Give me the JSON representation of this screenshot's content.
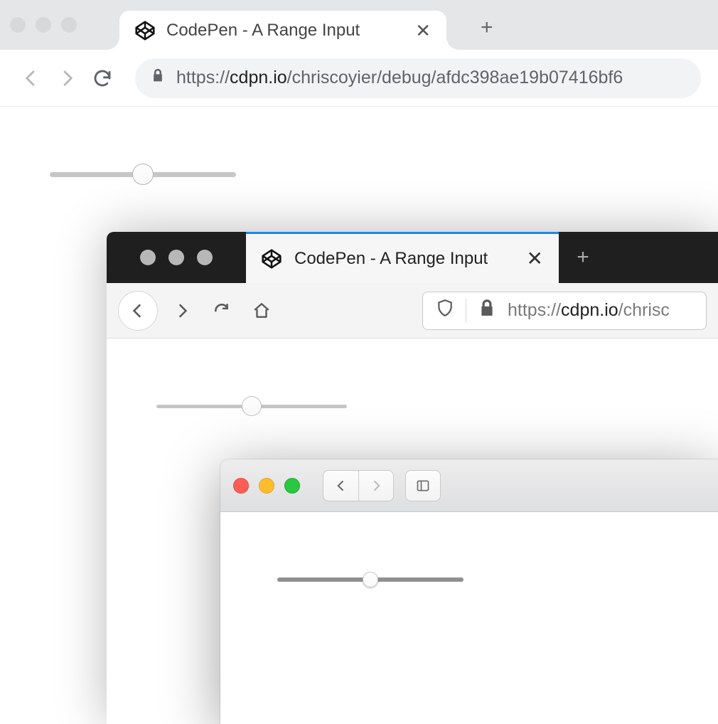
{
  "chrome": {
    "tab_title": "CodePen - A Range Input",
    "url_prefix": "https://",
    "url_host": "cdpn.io",
    "url_path": "/chriscoyier/debug/afdc398ae19b07416bf6",
    "range_value": 50
  },
  "firefox": {
    "tab_title": "CodePen - A Range Input",
    "url_prefix": "https://",
    "url_host": "cdpn.io",
    "url_path": "/chrisc",
    "range_value": 50
  },
  "safari": {
    "range_value": 50
  }
}
